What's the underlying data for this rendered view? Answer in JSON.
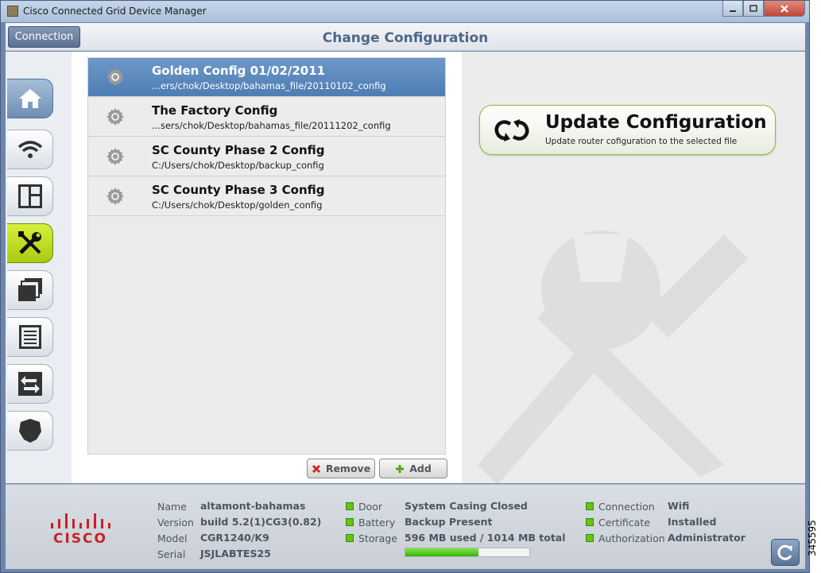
{
  "window": {
    "title": "Cisco Connected Grid Device Manager"
  },
  "header": {
    "connection_label": "Connection",
    "page_title": "Change Configuration"
  },
  "sidebar": {
    "items": [
      {
        "icon": "home-icon",
        "active": false
      },
      {
        "icon": "wifi-icon",
        "active": false
      },
      {
        "icon": "dashboard-icon",
        "active": false
      },
      {
        "icon": "tools-icon",
        "active": true
      },
      {
        "icon": "windows-icon",
        "active": false
      },
      {
        "icon": "list-icon",
        "active": false
      },
      {
        "icon": "transfer-icon",
        "active": false
      },
      {
        "icon": "shield-icon",
        "active": false
      }
    ]
  },
  "configs": [
    {
      "name": "Golden Config 01/02/2011",
      "path": "...ers/chok/Desktop/bahamas_file/20110102_config",
      "selected": true
    },
    {
      "name": "The Factory Config",
      "path": "...sers/chok/Desktop/bahamas_file/20111202_config",
      "selected": false
    },
    {
      "name": "SC County Phase 2 Config",
      "path": "C:/Users/chok/Desktop/backup_config",
      "selected": false
    },
    {
      "name": "SC County Phase 3 Config",
      "path": "C:/Users/chok/Desktop/golden_config",
      "selected": false
    }
  ],
  "list_actions": {
    "remove_label": "Remove",
    "add_label": "Add"
  },
  "update": {
    "title": "Update Configuration",
    "subtitle": "Update router cofiguration to the selected file"
  },
  "status": {
    "device": {
      "name_label": "Name",
      "name": "altamont-bahamas",
      "version_label": "Version",
      "version": "build 5.2(1)CG3(0.82)",
      "model_label": "Model",
      "model": "CGR1240/K9",
      "serial_label": "Serial",
      "serial": "JSJLABTES25"
    },
    "hardware": {
      "door_label": "Door",
      "door": "System Casing Closed",
      "battery_label": "Battery",
      "battery": "Backup Present",
      "storage_label": "Storage",
      "storage": "596 MB used / 1014 MB total",
      "storage_fraction": 0.588
    },
    "network": {
      "connection_label": "Connection",
      "connection": "Wifi",
      "certificate_label": "Certificate",
      "certificate": "Installed",
      "authorization_label": "Authorization",
      "authorization": "Administrator"
    }
  },
  "brand": {
    "logo_text": "CISCO"
  },
  "colors": {
    "accent": "#a8cc12",
    "selected": "#4e7db3",
    "status_ok": "#5fc71a",
    "title": "#4e6688"
  },
  "figure_id": "345595"
}
